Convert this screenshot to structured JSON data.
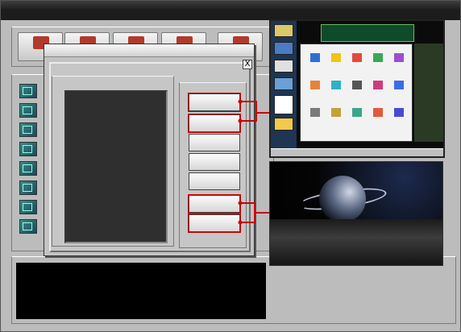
{
  "app": {
    "title": "",
    "status": ""
  },
  "function_group": {
    "label": "",
    "first_button_caption": ""
  },
  "machine_group": {
    "label": ""
  },
  "summary_group": {
    "label": "",
    "log_lines": [
      "",
      "",
      ""
    ]
  },
  "dialog": {
    "title": "",
    "close": "X",
    "items_label": "",
    "items": [
      ""
    ],
    "buttons": {
      "start": "",
      "time": "",
      "other": "",
      "pause": "",
      "resume": "",
      "transfer": "",
      "checkout": ""
    }
  },
  "preview_top": {
    "banner_title": "",
    "banner_sub": ""
  },
  "preview_bottom": {
    "machine_title": "",
    "message": ""
  },
  "colors": {
    "highlight": "#cc0000",
    "green_text": "#7cff7c",
    "alert_red": "#ff2e2e"
  }
}
